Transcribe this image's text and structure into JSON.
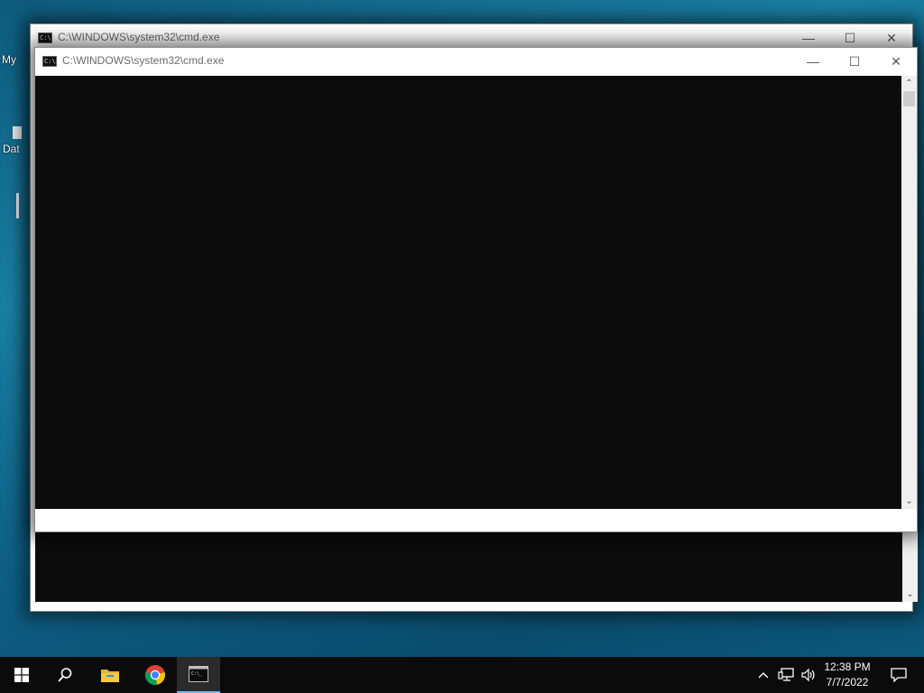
{
  "desktop": {
    "icons": [
      {
        "label": "My"
      },
      {
        "label": "Dat"
      }
    ]
  },
  "back_window": {
    "title": "C:\\WINDOWS\\system32\\cmd.exe"
  },
  "front_window": {
    "title": "C:\\WINDOWS\\system32\\cmd.exe"
  },
  "window_controls": {
    "minimize": "—",
    "maximize": "☐",
    "close": "✕"
  },
  "taskbar": {
    "start_icon": "windows-logo-icon",
    "search_icon": "search-icon",
    "pinned": [
      "file-explorer-icon",
      "chrome-icon",
      "cmd-icon"
    ],
    "tray": {
      "time": "12:38 PM",
      "date": "7/7/2022"
    }
  }
}
